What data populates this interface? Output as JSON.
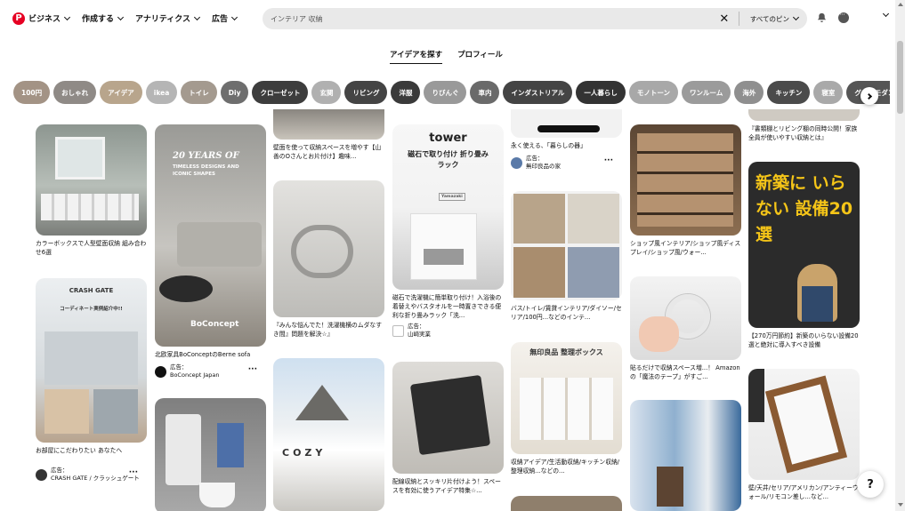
{
  "header": {
    "logo_glyph": "P",
    "menu": [
      {
        "label": "ビジネス"
      },
      {
        "label": "作成する"
      },
      {
        "label": "アナリティクス"
      },
      {
        "label": "広告"
      }
    ],
    "search": {
      "value": "インテリア 収納",
      "scope": "すべてのピン"
    }
  },
  "tabs": [
    {
      "label": "アイデアを探す",
      "active": true
    },
    {
      "label": "プロフィール",
      "active": false
    }
  ],
  "chips": [
    {
      "label": "100円",
      "color": "#a39385"
    },
    {
      "label": "おしゃれ",
      "color": "#8f8a86"
    },
    {
      "label": "アイデア",
      "color": "#b8a58c"
    },
    {
      "label": "ikea",
      "color": "#b5b5b5"
    },
    {
      "label": "トイレ",
      "color": "#a49a8f"
    },
    {
      "label": "Diy",
      "color": "#6e6e6e"
    },
    {
      "label": "クローゼット",
      "color": "#3d3d3d"
    },
    {
      "label": "玄関",
      "color": "#b0b0b0"
    },
    {
      "label": "リビング",
      "color": "#444444"
    },
    {
      "label": "洋服",
      "color": "#3a3a3a"
    },
    {
      "label": "りびんぐ",
      "color": "#999999"
    },
    {
      "label": "車内",
      "color": "#6a6a6a"
    },
    {
      "label": "インダストリアル",
      "color": "#444444"
    },
    {
      "label": "一人暮らし",
      "color": "#333333"
    },
    {
      "label": "モノトーン",
      "color": "#a8a8a8"
    },
    {
      "label": "ワンルーム",
      "color": "#9b9b9b"
    },
    {
      "label": "海外",
      "color": "#8f8f8f"
    },
    {
      "label": "キッチン",
      "color": "#4b4b4b"
    },
    {
      "label": "寝室",
      "color": "#a9a9a9"
    },
    {
      "label": "グレーモダン",
      "color": "#555555"
    }
  ],
  "pins": [
    {
      "title": "カラーボックスで人型壁面収納 組み合わせ6選"
    },
    {
      "title": "お部屋にこだわりたい あなたへ",
      "ad_label": "広告：",
      "advertiser": "CRASH GATE / クラッシュゲート",
      "img_heading": "CRASH GATE",
      "img_sub": "コーディネート実例紹介中!!"
    },
    {
      "title": "北欧家具BoConceptのBerne sofa",
      "ad_label": "広告：",
      "advertiser": "BoConcept Japan",
      "img_heading": "20 YEARS OF",
      "img_sub": "TIMELESS DESIGNS AND ICONIC SHAPES",
      "brand": "BoConcept"
    },
    {
      "title": ""
    },
    {
      "title": "壁面を使って収納スペースを増やす【山善のOさんとお片付け】趣味..."
    },
    {
      "title": "『みんな悩んでた！洗濯機横のムダなすき間』問題を解決☆』"
    },
    {
      "title": "",
      "img_heading": "COZY"
    },
    {
      "title": "磁石で洗濯機に簡単取り付け！入浴後の着替えやバスタオルを一時置きできる便利な折り畳みラック「洗...",
      "ad_label": "広告：",
      "advertiser": "山崎実業",
      "img_heading": "tower",
      "img_sub": "磁石で取り付け 折り畳みラック",
      "badge": "Yamazaki"
    },
    {
      "title": "配線収納とスッキリ片付けよう！スペースを有効に使うアイデア特集☆..."
    },
    {
      "title": "永く使える、「暮らしの器」",
      "ad_label": "広告：",
      "advertiser": "無印良品の家"
    },
    {
      "title": "バス/トイレ/賃貸インテリア/ダイソー/セリア/100円...などのインテ..."
    },
    {
      "title": "収納アイデア/生活動収納/キッチン収納/整理収納...などの...",
      "img_heading": "無印良品 整理ボックス"
    },
    {
      "title": ""
    },
    {
      "title": "ショップ風インテリア/ショップ風ディスプレイ/ショップ風/ウォー..."
    },
    {
      "title": "貼るだけで収納スペース増...！ Amazonの「魔法のテープ」がすご..."
    },
    {
      "title": ""
    },
    {
      "title": "『書類棚とリビング棚の同時公開！家族全員が使いやすい収納とは』"
    },
    {
      "title": "【270万円節約】新築のいらない設備20選と絶対に導入すべき設備",
      "img_heading": "新築に いらない 設備20選"
    },
    {
      "title": "壁/天井/セリア/アメリカン/アンティーウォール/リモコン差し...など..."
    }
  ],
  "help_label": "?"
}
